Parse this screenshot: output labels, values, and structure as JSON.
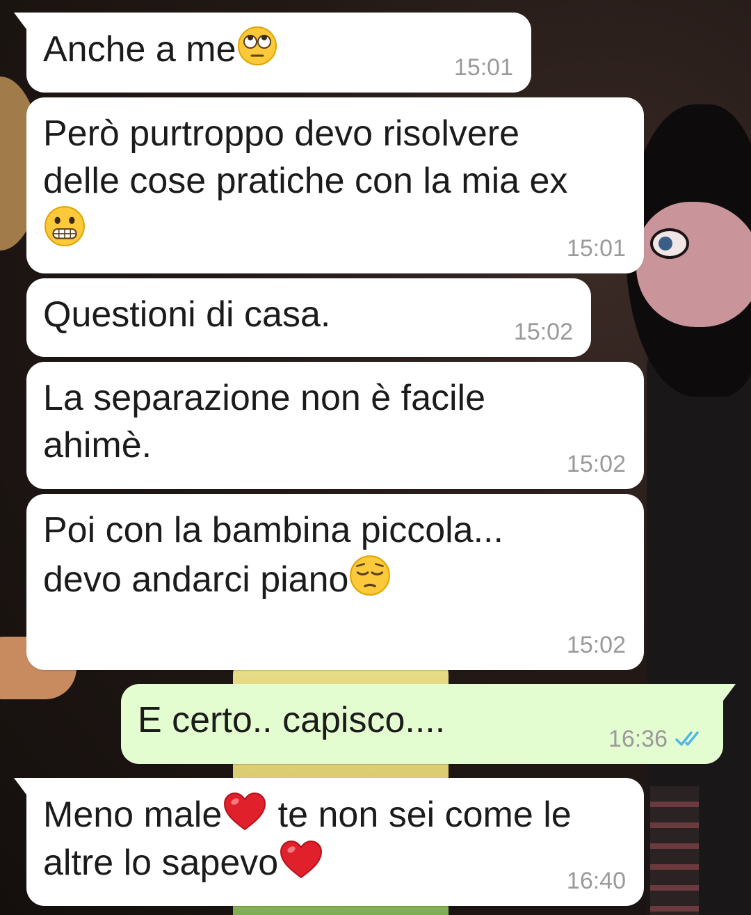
{
  "messages": [
    {
      "direction": "incoming",
      "parts": [
        "Anche a me"
      ],
      "emoji": "face-with-rolling-eyes",
      "time": "15:01"
    },
    {
      "direction": "incoming",
      "lines": [
        "Però purtroppo devo risolvere",
        "delle cose pratiche con la mia ex"
      ],
      "emoji": "grimacing-face",
      "time": "15:01"
    },
    {
      "direction": "incoming",
      "text": "Questioni di casa.",
      "time": "15:02"
    },
    {
      "direction": "incoming",
      "lines": [
        "La separazione non è facile",
        "ahimè."
      ],
      "time": "15:02"
    },
    {
      "direction": "incoming",
      "lines": [
        "Poi con la bambina piccola...",
        "devo andarci piano"
      ],
      "emoji": "pensive-face",
      "time": "15:02"
    },
    {
      "direction": "outgoing",
      "text": "E certo.. capisco....",
      "time": "16:36",
      "status": "read",
      "status_icon": "double-check-icon"
    },
    {
      "direction": "incoming",
      "parts": [
        "Meno male",
        " te non sei come le",
        "altre lo sapevo"
      ],
      "emoji": "red-heart",
      "time": "16:40"
    }
  ],
  "colors": {
    "incoming_bubble": "#ffffff",
    "outgoing_bubble": "#e4fdd0",
    "timestamp": "#9a9a9a",
    "read_ticks": "#4fb6ec"
  }
}
